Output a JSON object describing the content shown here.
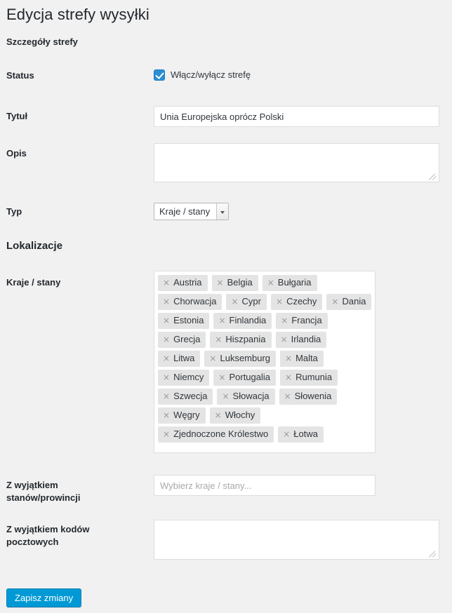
{
  "page": {
    "title": "Edycja strefy wysyłki"
  },
  "sections": {
    "details_heading": "Szczegóły strefy",
    "locations_heading": "Lokalizacje"
  },
  "fields": {
    "status": {
      "label": "Status",
      "checkbox_label": "Włącz/wyłącz strefę",
      "checked": true
    },
    "title": {
      "label": "Tytuł",
      "value": "Unia Europejska oprócz Polski"
    },
    "description": {
      "label": "Opis",
      "value": ""
    },
    "type": {
      "label": "Typ",
      "selected": "Kraje / stany"
    },
    "countries": {
      "label": "Kraje / stany",
      "tags": [
        "Austria",
        "Belgia",
        "Bułgaria",
        "Chorwacja",
        "Cypr",
        "Czechy",
        "Dania",
        "Estonia",
        "Finlandia",
        "Francja",
        "Grecja",
        "Hiszpania",
        "Irlandia",
        "Litwa",
        "Luksemburg",
        "Malta",
        "Niemcy",
        "Portugalia",
        "Rumunia",
        "Szwecja",
        "Słowacja",
        "Słowenia",
        "Węgry",
        "Włochy",
        "Zjednoczone Królestwo",
        "Łotwa"
      ],
      "remove_icon": "×"
    },
    "except_states": {
      "label": "Z wyjątkiem\nstanów/prowincji",
      "placeholder": "Wybierz kraje / stany...",
      "value": ""
    },
    "except_postcodes": {
      "label": "Z wyjątkiem kodów\npocztowych",
      "value": ""
    }
  },
  "actions": {
    "save_label": "Zapisz zmiany"
  },
  "colors": {
    "background": "#f1f1f1",
    "accent": "#0099d5",
    "checkbox": "#2a8fd4",
    "tag_bg": "#e4e4e4"
  }
}
